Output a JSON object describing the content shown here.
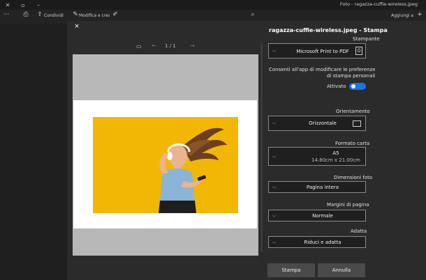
{
  "window": {
    "title": "Foto - ragazza-cuffie-wireless.jpeg"
  },
  "toolbar": {
    "add_label": "Aggiungi a",
    "share_label": "Condividi",
    "edit_label": "Modifica e crea"
  },
  "dialog": {
    "close_icon": "×",
    "pager": "1 / 1"
  },
  "panel": {
    "title": "ragazza-cuffie-wireless.jpeg - Stampa",
    "printer_label": "Stampante",
    "printer_value": "Microsoft Print to PDF",
    "app_pref_text_1": "Consenti all'app di modificare le preferenze",
    "app_pref_text_2": "di stampa personali",
    "toggle_label": "Attivato",
    "toggle_on": true,
    "orientation_label": "Orientamento",
    "orientation_value": "Orizzontale",
    "paper_label": "Formato carta",
    "paper_value_1": "A5",
    "paper_value_2": "14.80cm x 21.00cm",
    "photo_size_label": "Dimensioni foto",
    "photo_size_value": "Pagina intera",
    "margins_label": "Margini di pagina",
    "margins_value": "Normale",
    "fit_label": "Adatta",
    "fit_value": "Riduci e adatta",
    "print_button": "Stampa",
    "cancel_button": "Annulla"
  },
  "colors": {
    "accent": "#1a73e8",
    "photo_background": "#f2b705"
  }
}
